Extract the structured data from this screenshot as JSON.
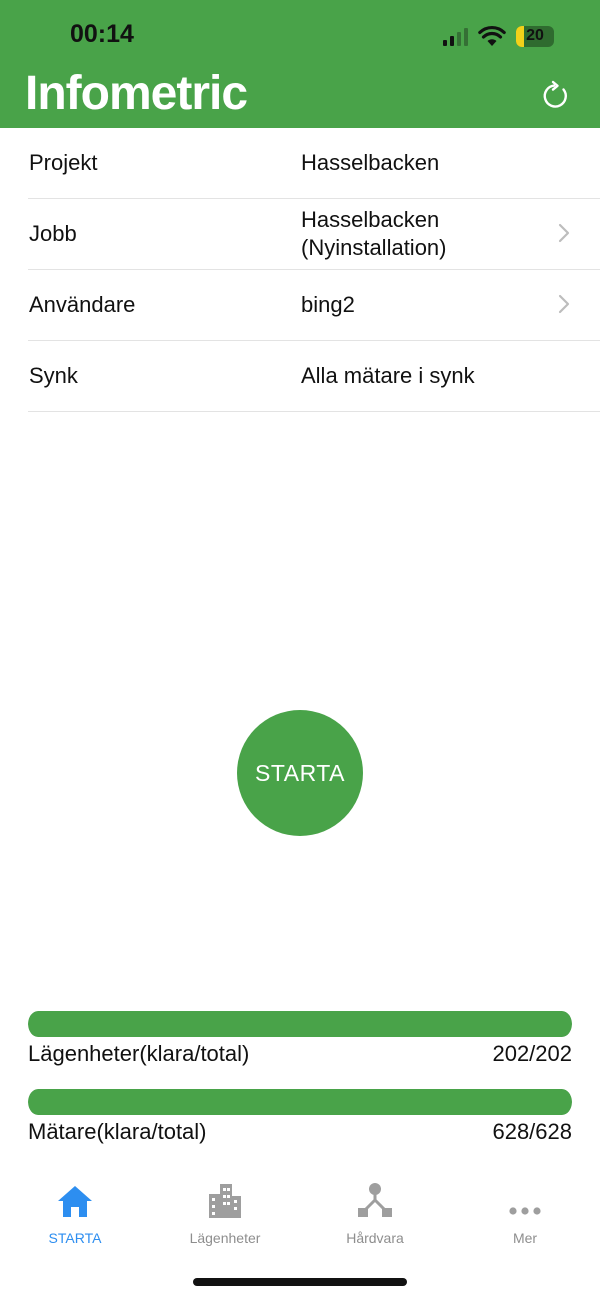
{
  "status_bar": {
    "time": "00:14",
    "battery": "20"
  },
  "app": {
    "title": "Infometric"
  },
  "info_rows": [
    {
      "label": "Projekt",
      "value": "Hasselbacken"
    },
    {
      "label": "Jobb",
      "value": "Hasselbacken",
      "value2": "(Nyinstallation)"
    },
    {
      "label": "Användare",
      "value": "bing2"
    },
    {
      "label": "Synk",
      "value": "Alla mätare i synk"
    }
  ],
  "start_button": {
    "label": "STARTA"
  },
  "progress": [
    {
      "label": "Lägenheter(klara/total)",
      "value": "202/202",
      "fraction": 1.0
    },
    {
      "label": "Mätare(klara/total)",
      "value": "628/628",
      "fraction": 1.0
    }
  ],
  "tabs": [
    {
      "label": "STARTA",
      "icon": "home-icon"
    },
    {
      "label": "Lägenheter",
      "icon": "building-icon"
    },
    {
      "label": "Hårdvara",
      "icon": "network-icon"
    },
    {
      "label": "Mer",
      "icon": "more-icon"
    }
  ],
  "colors": {
    "accent": "#49a349",
    "tab_active": "#2d8ef0",
    "tab_inactive": "#8e8e8e"
  }
}
